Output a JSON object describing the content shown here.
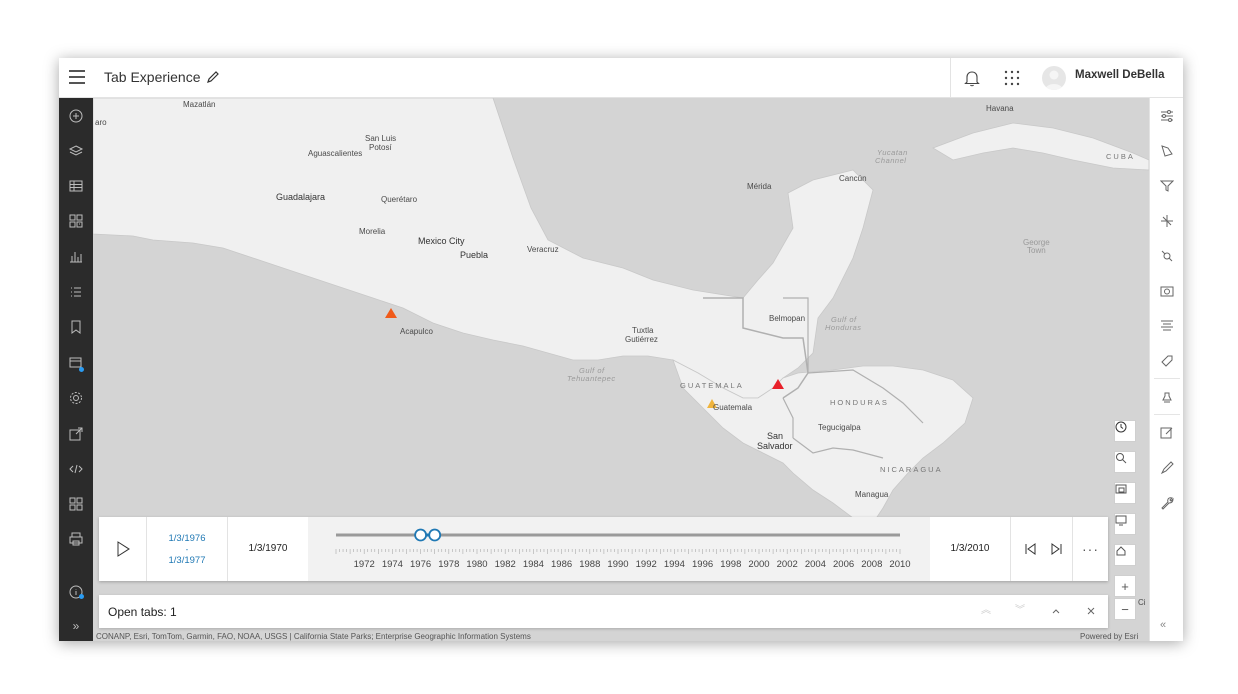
{
  "header": {
    "title": "Tab Experience",
    "user_name": "Maxwell DeBella"
  },
  "map": {
    "labels": {
      "mazatlan": "Mazatlán",
      "aro": "aro",
      "san_luis_potosi_1": "San Luis",
      "san_luis_potosi_2": "Potosí",
      "aguascalientes": "Aguascalientes",
      "guadalajara": "Guadalajara",
      "queretaro": "Querétaro",
      "morelia": "Morelia",
      "mexico_city": "Mexico City",
      "puebla": "Puebla",
      "veracruz": "Veracruz",
      "acapulco": "Acapulco",
      "merida": "Mérida",
      "cancun": "Cancún",
      "havana": "Havana",
      "cuba": "CUBA",
      "yucatan_channel_1": "Yucatan",
      "yucatan_channel_2": "Channel",
      "george_town_1": "George",
      "george_town_2": "Town",
      "belmopan": "Belmopan",
      "gulf_honduras_1": "Gulf of",
      "gulf_honduras_2": "Honduras",
      "tuxtla_1": "Tuxtla",
      "tuxtla_2": "Gutiérrez",
      "gulf_tehuantepec_1": "Gulf of",
      "gulf_tehuantepec_2": "Tehuantepec",
      "guatemala_country": "GUATEMALA",
      "guatemala_city": "Guatemala",
      "honduras": "HONDURAS",
      "tegucigalpa": "Tegucigalpa",
      "san_salvador_1": "San",
      "san_salvador_2": "Salvador",
      "nicaragua": "NICARAGUA",
      "managua": "Managua",
      "ci": "Ci"
    },
    "markers": [
      {
        "name": "acapulco-event",
        "color": "#f05a1a"
      },
      {
        "name": "guatemala-event",
        "color": "#f0b43c"
      },
      {
        "name": "honduras-border-event",
        "color": "#e8202a"
      }
    ]
  },
  "timeslider": {
    "range_start": "1/3/1976",
    "range_dash": "-",
    "range_end": "1/3/1977",
    "min_label": "1/3/1970",
    "max_label": "1/3/2010",
    "ticks": [
      "1972",
      "1974",
      "1976",
      "1978",
      "1980",
      "1982",
      "1984",
      "1986",
      "1988",
      "1990",
      "1992",
      "1994",
      "1996",
      "1998",
      "2000",
      "2002",
      "2004",
      "2006",
      "2008",
      "2010"
    ],
    "thumb_start_year": 1976,
    "thumb_end_year": 1977,
    "axis_min_year": 1970,
    "axis_max_year": 2010,
    "more_label": "···"
  },
  "tabbar": {
    "label": "Open tabs: 1"
  },
  "footer": {
    "attribution": "CONANP, Esri, TomTom, Garmin, FAO, NOAA, USGS | California State Parks; Enterprise Geographic Information Systems",
    "powered_by": "Powered by Esri"
  },
  "map_controls": {
    "zoom_in": "+",
    "zoom_out": "−"
  },
  "colors": {
    "accent": "#1f78b4",
    "left_bar": "#2b2b2b",
    "notification_dot": "#2a9cf3"
  }
}
